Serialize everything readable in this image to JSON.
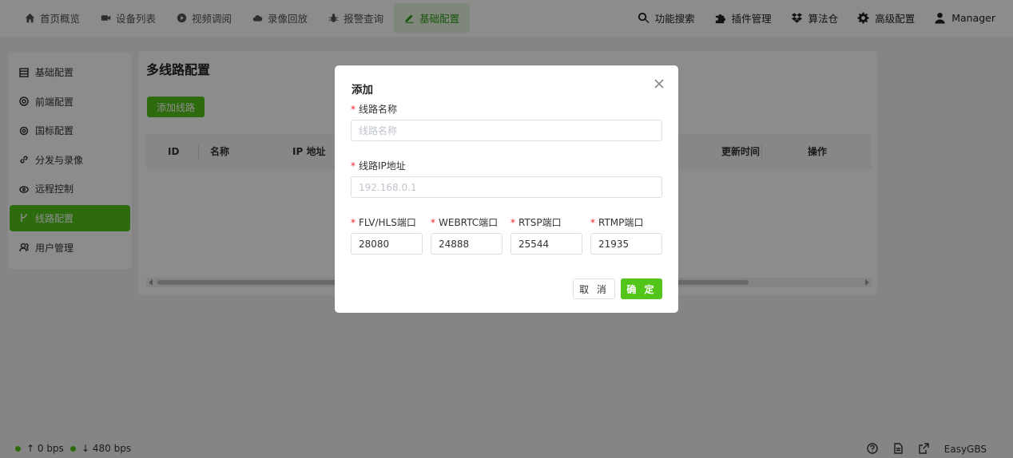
{
  "nav": {
    "left": [
      {
        "label": "首页概览",
        "icon": "home-icon"
      },
      {
        "label": "设备列表",
        "icon": "video-camera-icon"
      },
      {
        "label": "视频调阅",
        "icon": "play-circle-icon"
      },
      {
        "label": "录像回放",
        "icon": "cloud-icon"
      },
      {
        "label": "报警查询",
        "icon": "bug-icon"
      },
      {
        "label": "基础配置",
        "icon": "edit-icon",
        "active": true
      }
    ],
    "right": [
      {
        "label": "功能搜索",
        "icon": "search-icon"
      },
      {
        "label": "插件管理",
        "icon": "puzzle-icon"
      },
      {
        "label": "算法仓",
        "icon": "dropbox-icon"
      },
      {
        "label": "高级配置",
        "icon": "gear-icon"
      },
      {
        "label": "Manager",
        "icon": "user-icon"
      }
    ]
  },
  "sidebar": {
    "items": [
      {
        "label": "基础配置",
        "icon": "list-icon"
      },
      {
        "label": "前端配置",
        "icon": "target-icon"
      },
      {
        "label": "国标配置",
        "icon": "gear-icon"
      },
      {
        "label": "分发与录像",
        "icon": "link-icon"
      },
      {
        "label": "远程控制",
        "icon": "remote-icon"
      },
      {
        "label": "线路配置",
        "icon": "branch-icon",
        "active": true
      },
      {
        "label": "用户管理",
        "icon": "users-icon"
      }
    ]
  },
  "main": {
    "title": "多线路配置",
    "add_button": "添加线路",
    "columns": [
      "ID",
      "名称",
      "IP 地址",
      "更新时间",
      "操作"
    ]
  },
  "footer": {
    "up": "↑ 0 bps",
    "down": "↓ 480 bps",
    "brand": "EasyGBS"
  },
  "modal": {
    "title": "添加",
    "name_label": "线路名称",
    "name_placeholder": "线路名称",
    "ip_label": "线路IP地址",
    "ip_placeholder": "192.168.0.1",
    "ports": [
      {
        "label": "FLV/HLS端口",
        "value": "28080"
      },
      {
        "label": "WEBRTC端口",
        "value": "24888"
      },
      {
        "label": "RTSP端口",
        "value": "25544"
      },
      {
        "label": "RTMP端口",
        "value": "21935"
      }
    ],
    "cancel": "取 消",
    "ok": "确 定"
  },
  "colors": {
    "accent": "#52c41a",
    "active_nav_bg": "#e6f6df",
    "required": "#f5222d"
  }
}
